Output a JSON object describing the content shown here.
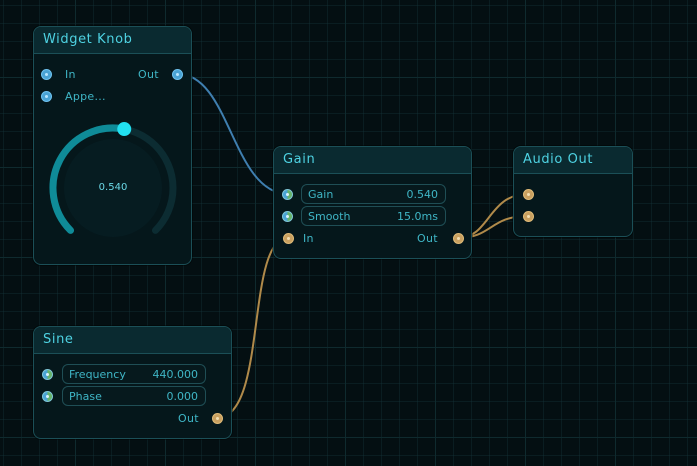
{
  "colors": {
    "accent": "#2fd8e6",
    "control_wire": "#3f7fb0",
    "audio_wire": "#b08a4a",
    "node_border": "#1b4f57"
  },
  "nodes": {
    "widget_knob": {
      "title": "Widget Knob",
      "in_label": "In",
      "out_label": "Out",
      "appearance_label": "Appe...",
      "knob_value_text": "0.540",
      "knob_fraction": 0.54
    },
    "gain": {
      "title": "Gain",
      "params": [
        {
          "name": "Gain",
          "value": "0.540"
        },
        {
          "name": "Smooth",
          "value": "15.0ms"
        }
      ],
      "in_label": "In",
      "out_label": "Out"
    },
    "audio_out": {
      "title": "Audio Out"
    },
    "sine": {
      "title": "Sine",
      "params": [
        {
          "name": "Frequency",
          "value": "440.000"
        },
        {
          "name": "Phase",
          "value": "0.000"
        }
      ],
      "out_label": "Out"
    }
  }
}
